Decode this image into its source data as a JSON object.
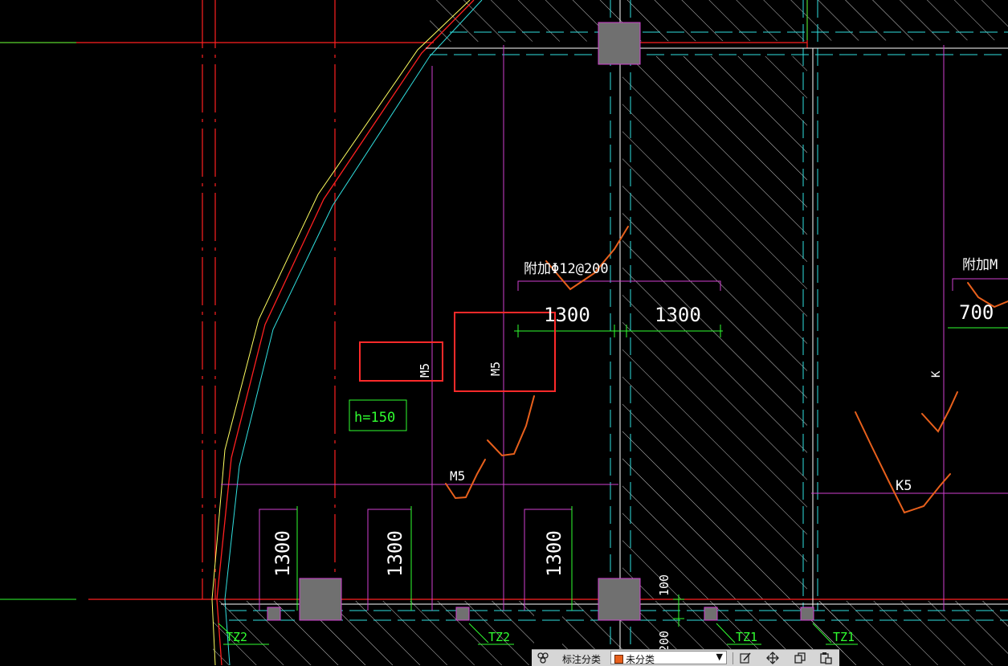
{
  "drawing": {
    "annotations": {
      "rebar_note_1": "附加Φ12@200",
      "rebar_note_2": "附加M",
      "dim_1300_a": "1300",
      "dim_1300_b": "1300",
      "dim_700": "700",
      "dim_v_1": "1300",
      "dim_v_2": "1300",
      "dim_v_3": "1300",
      "dim_100": "100",
      "dim_200": "200",
      "label_m5_box1": "M5",
      "label_m5_box2": "M5",
      "label_m5_bottom": "M5",
      "label_k": "K",
      "label_k5": "K5",
      "height_note": "h=150",
      "tz2_a": "TZ2",
      "tz2_b": "TZ2",
      "tz1_a": "TZ1",
      "tz1_b": "TZ1"
    },
    "colors": {
      "background": "#000000",
      "axis_red": "#ff2020",
      "slab_magenta": "#d040d0",
      "dim_green": "#30ff30",
      "edge_cyan": "#30e0e0",
      "hatch_grey": "#c8c8c8",
      "column_grey": "#707070",
      "markup_orange": "#e8601c",
      "highlight_red": "#ff2a2a",
      "yellow_edge": "#ffff60"
    }
  },
  "toolbar": {
    "category_label": "标注分类",
    "category_value": "未分类",
    "icons": [
      "layers-icon",
      "edit-icon",
      "move-icon",
      "copy-icon",
      "paste-icon"
    ]
  }
}
